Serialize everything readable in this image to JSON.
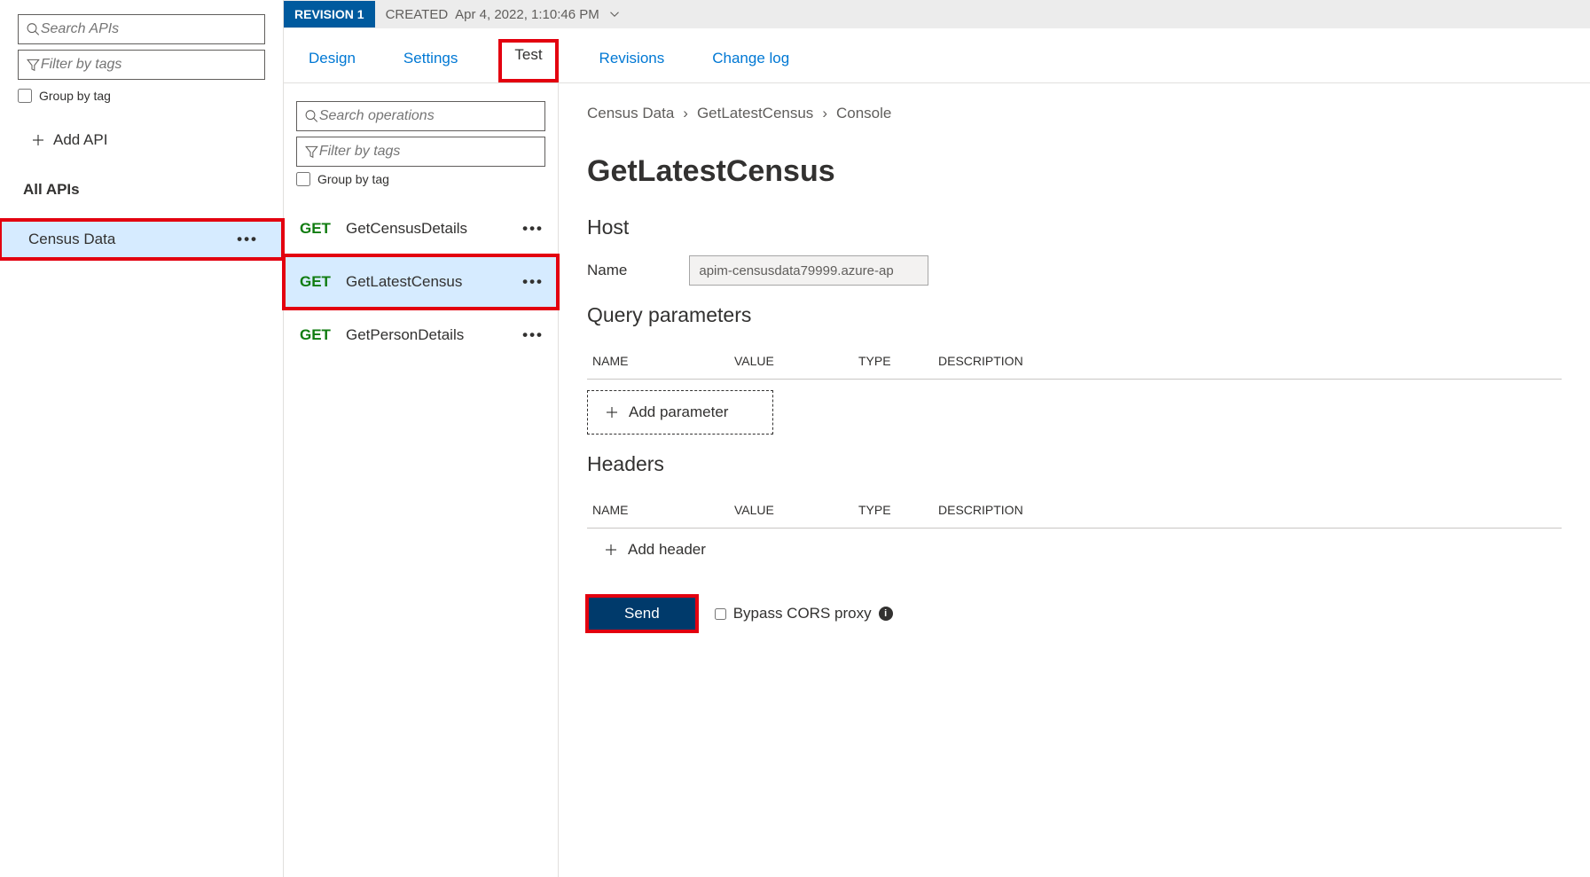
{
  "left": {
    "search_placeholder": "Search APIs",
    "filter_placeholder": "Filter by tags",
    "group_label": "Group by tag",
    "add_api_label": "Add API",
    "section_title": "All APIs",
    "apis": [
      {
        "name": "Census Data",
        "selected": true
      }
    ]
  },
  "header": {
    "revision_label": "REVISION 1",
    "created_prefix": "CREATED",
    "created_value": "Apr 4, 2022, 1:10:46 PM"
  },
  "tabs": {
    "design": "Design",
    "settings": "Settings",
    "test": "Test",
    "revisions": "Revisions",
    "changelog": "Change log",
    "active": "test"
  },
  "ops_panel": {
    "search_placeholder": "Search operations",
    "filter_placeholder": "Filter by tags",
    "group_label": "Group by tag",
    "operations": [
      {
        "method": "GET",
        "name": "GetCensusDetails",
        "selected": false
      },
      {
        "method": "GET",
        "name": "GetLatestCensus",
        "selected": true
      },
      {
        "method": "GET",
        "name": "GetPersonDetails",
        "selected": false
      }
    ]
  },
  "detail": {
    "breadcrumb": [
      "Census Data",
      "GetLatestCensus",
      "Console"
    ],
    "title": "GetLatestCensus",
    "host_section": "Host",
    "host_name_label": "Name",
    "host_value": "apim-censusdata79999.azure-ap",
    "query_section": "Query parameters",
    "headers_section": "Headers",
    "columns": {
      "name": "NAME",
      "value": "VALUE",
      "type": "TYPE",
      "description": "DESCRIPTION"
    },
    "add_parameter": "Add parameter",
    "add_header": "Add header",
    "send_label": "Send",
    "bypass_label": "Bypass CORS proxy"
  }
}
